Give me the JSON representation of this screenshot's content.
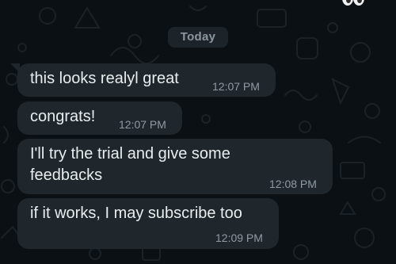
{
  "conversation": {
    "day_label": "Today",
    "messages": [
      {
        "text": "this looks realyl great",
        "time": "12:07 PM"
      },
      {
        "text": "congrats!",
        "time": "12:07 PM"
      },
      {
        "text": "I'll try the trial and give some\nfeedbacks",
        "time": "12:08 PM"
      },
      {
        "text": "if it works, I may subscribe too",
        "time": "12:09 PM"
      }
    ]
  },
  "header": {
    "partial_icon": "eyes-emoji-icon"
  },
  "colors": {
    "background": "#0b1014",
    "bubble": "#1f272d",
    "message_text": "#e9edef",
    "timestamp": "#8f9aa1",
    "day_chip": "#1c2329"
  }
}
